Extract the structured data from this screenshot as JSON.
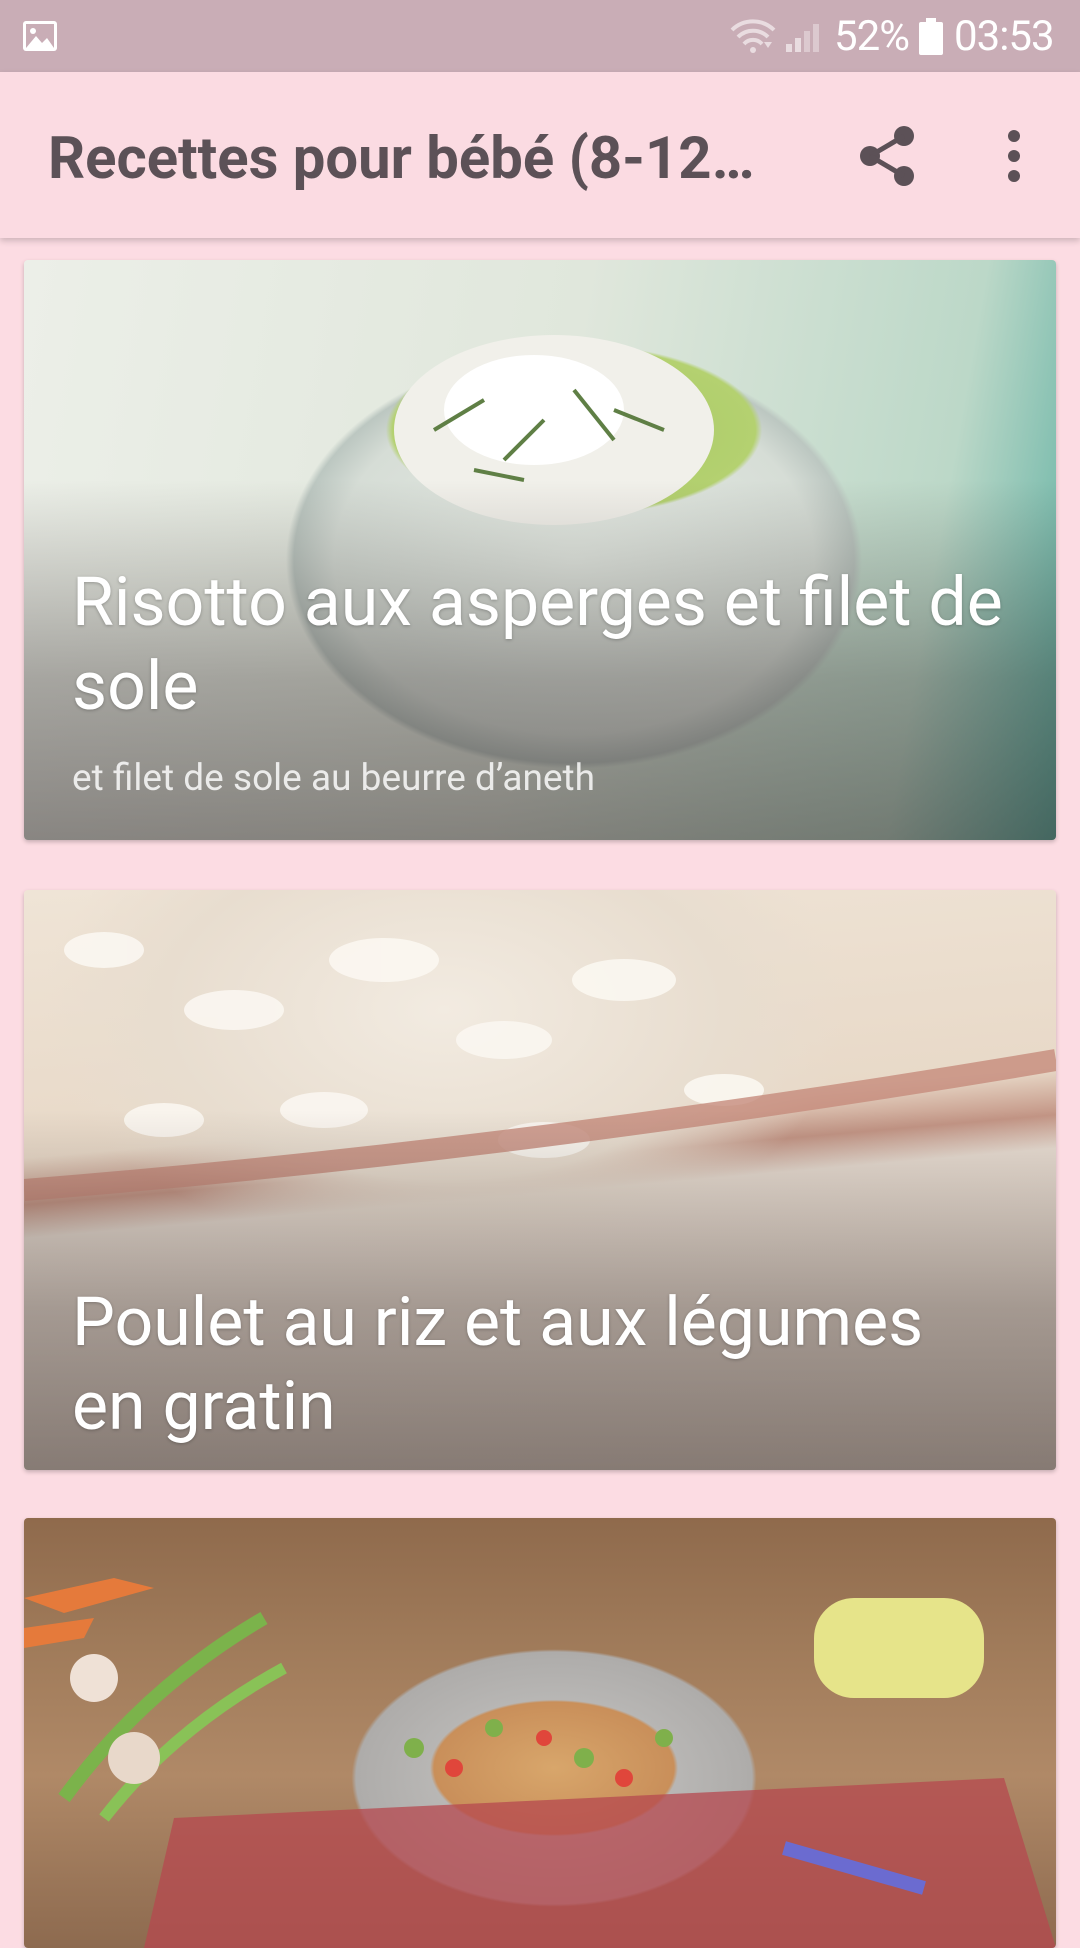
{
  "status_bar": {
    "battery_percent": "52%",
    "time": "03:53",
    "icons": [
      "gallery-icon",
      "wifi-icon",
      "signal-icon",
      "battery-icon"
    ]
  },
  "app_bar": {
    "title": "Recettes pour bébé (8-12…",
    "actions": [
      "share-icon",
      "more-vert-icon"
    ]
  },
  "recipes": [
    {
      "title": "Risotto aux asperges et filet de sole",
      "subtitle": "et filet de sole au beurre d’aneth"
    },
    {
      "title": "Poulet au riz et aux légumes en gratin"
    },
    {
      "title": ""
    }
  ],
  "colors": {
    "status_bar": "#c9adb6",
    "app_bar": "#fbdbe2",
    "background": "#fcdce3",
    "title_text": "#5c5157"
  }
}
